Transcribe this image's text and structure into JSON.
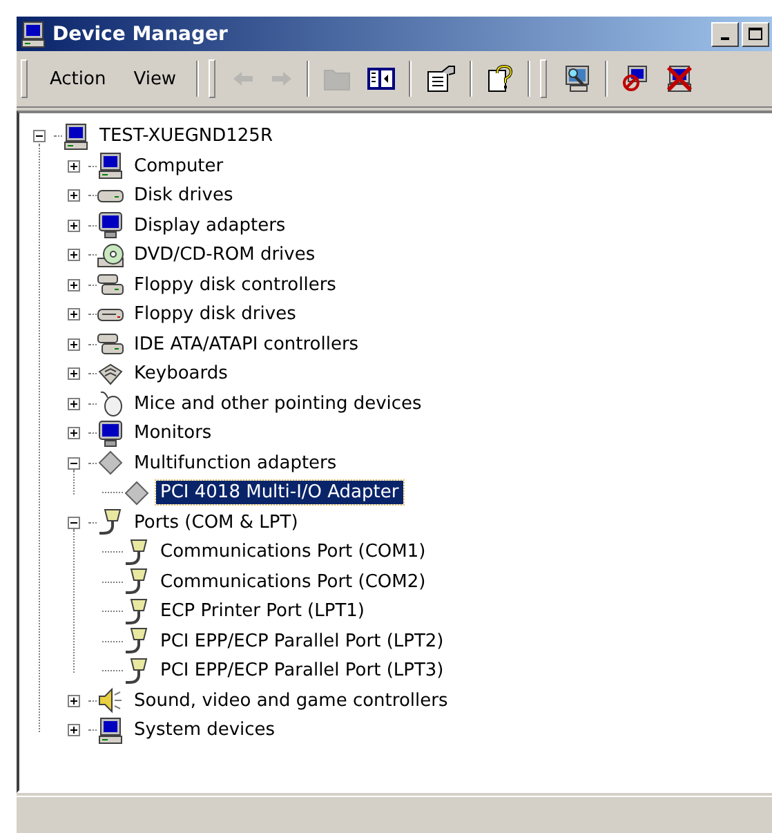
{
  "window": {
    "title": "Device Manager"
  },
  "menu": [
    {
      "label": "Action"
    },
    {
      "label": "View"
    }
  ],
  "toolbar": [
    {
      "kind": "back",
      "disabled": true
    },
    {
      "kind": "forward",
      "disabled": true
    },
    {
      "kind": "up",
      "disabled": true
    },
    {
      "kind": "tree",
      "disabled": false
    },
    {
      "kind": "properties",
      "disabled": false
    },
    {
      "kind": "help",
      "disabled": false
    },
    {
      "kind": "scan",
      "disabled": false
    },
    {
      "kind": "disable",
      "disabled": false
    },
    {
      "kind": "uninstall",
      "disabled": false
    }
  ],
  "tree": [
    {
      "label": "TEST-XUEGND125R",
      "kind": "host",
      "expanded": true,
      "selected": false,
      "children": [
        {
          "label": "Computer",
          "kind": "computer",
          "expanded": false,
          "selected": false
        },
        {
          "label": "Disk drives",
          "kind": "disk",
          "expanded": false,
          "selected": false
        },
        {
          "label": "Display adapters",
          "kind": "display",
          "expanded": false,
          "selected": false
        },
        {
          "label": "DVD/CD-ROM drives",
          "kind": "cdrom",
          "expanded": false,
          "selected": false
        },
        {
          "label": "Floppy disk controllers",
          "kind": "controller",
          "expanded": false,
          "selected": false
        },
        {
          "label": "Floppy disk drives",
          "kind": "floppy",
          "expanded": false,
          "selected": false
        },
        {
          "label": "IDE ATA/ATAPI controllers",
          "kind": "controller",
          "expanded": false,
          "selected": false
        },
        {
          "label": "Keyboards",
          "kind": "keyboard",
          "expanded": false,
          "selected": false
        },
        {
          "label": "Mice and other pointing devices",
          "kind": "mouse",
          "expanded": false,
          "selected": false
        },
        {
          "label": "Monitors",
          "kind": "display",
          "expanded": false,
          "selected": false
        },
        {
          "label": "Multifunction adapters",
          "kind": "multifunction",
          "expanded": true,
          "selected": false,
          "children": [
            {
              "label": "PCI 4018 Multi-I/O Adapter",
              "kind": "multifunction",
              "selected": true
            }
          ]
        },
        {
          "label": "Ports (COM & LPT)",
          "kind": "port",
          "expanded": true,
          "selected": false,
          "children": [
            {
              "label": "Communications Port (COM1)",
              "kind": "port",
              "selected": false
            },
            {
              "label": "Communications Port (COM2)",
              "kind": "port",
              "selected": false
            },
            {
              "label": "ECP Printer Port (LPT1)",
              "kind": "port",
              "selected": false
            },
            {
              "label": "PCI EPP/ECP Parallel Port (LPT2)",
              "kind": "port",
              "selected": false
            },
            {
              "label": "PCI EPP/ECP Parallel Port (LPT3)",
              "kind": "port",
              "selected": false
            }
          ]
        },
        {
          "label": "Sound, video and game controllers",
          "kind": "sound",
          "expanded": false,
          "selected": false
        },
        {
          "label": "System devices",
          "kind": "computer",
          "expanded": false,
          "selected": false
        }
      ]
    }
  ]
}
